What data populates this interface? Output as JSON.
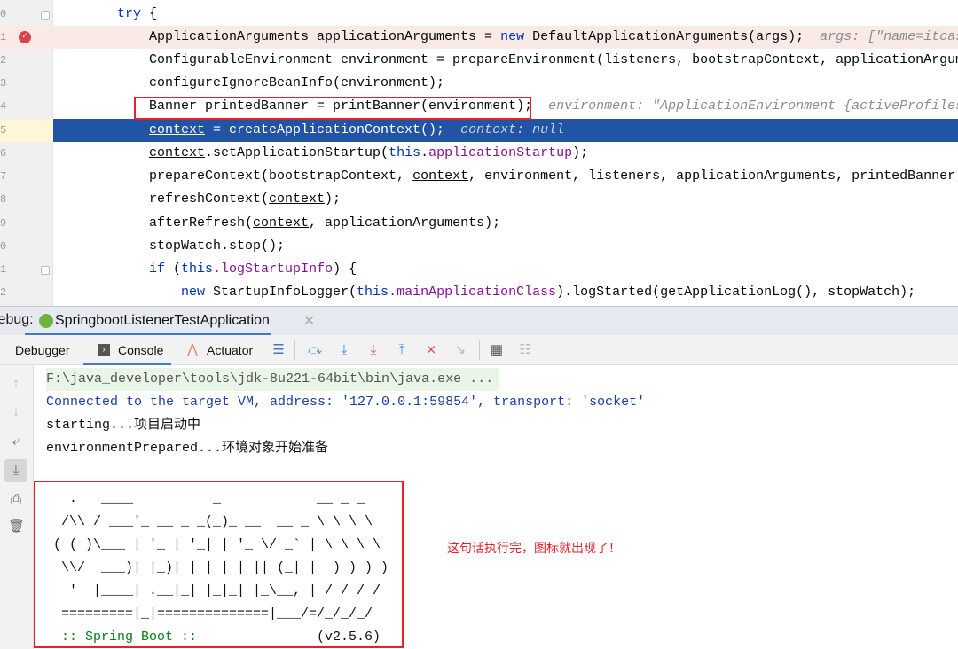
{
  "editor": {
    "lines": [
      {
        "num": "0",
        "parts": [
          {
            "t": "try {",
            "c": "kw-mix"
          }
        ]
      },
      {
        "num": "1"
      },
      {
        "num": "2"
      },
      {
        "num": "3"
      },
      {
        "num": "4"
      },
      {
        "num": "5"
      },
      {
        "num": "6"
      },
      {
        "num": "7"
      },
      {
        "num": "8"
      },
      {
        "num": "9"
      },
      {
        "num": "0"
      },
      {
        "num": "1"
      },
      {
        "num": "2"
      }
    ],
    "l0_kw": "try",
    "l0_rest": " {",
    "l1_code": "ApplicationArguments applicationArguments = ",
    "l1_new": "new",
    "l1_rest": " DefaultApplicationArguments(args);",
    "l1_hint": "args: [\"name=itcast\"]",
    "l2_code": "ConfigurableEnvironment environment = prepareEnvironment(listeners, bootstrapContext, applicationArguments);",
    "l3_code": "configureIgnoreBeanInfo(environment);",
    "l4_code": "Banner printedBanner = printBanner(environment);",
    "l4_hint": "environment: \"ApplicationEnvironment {activeProfiles=[]}\"",
    "l5_var": "context",
    "l5_rest": " = createApplicationContext();",
    "l5_hint": "context: null",
    "l6_var": "context",
    "l6_a": ".setApplicationStartup(",
    "l6_this": "this",
    "l6_dot": ".",
    "l6_fld": "applicationStartup",
    "l6_end": ");",
    "l7_a": "prepareContext(bootstrapContext, ",
    "l7_var": "context",
    "l7_b": ", environment, listeners, applicationArguments, printedBanner);",
    "l8_a": "refreshContext(",
    "l8_var": "context",
    "l8_b": ");",
    "l9_a": "afterRefresh(",
    "l9_var": "context",
    "l9_b": ", applicationArguments);",
    "l10_code": "stopWatch.stop();",
    "l11_if": "if",
    "l11_a": " (",
    "l11_this": "this",
    "l11_fld": ".logStartupInfo",
    "l11_b": ") {",
    "l12_new": "new",
    "l12_a": " StartupInfoLogger(",
    "l12_this": "this",
    "l12_fld": ".mainApplicationClass",
    "l12_b": ").logStarted(getApplicationLog(), stopWatch);"
  },
  "debug": {
    "label": "Debug:",
    "session_tab": "SpringbootListenerTestApplication",
    "tabs": [
      "Debugger",
      "Console",
      "Actuator"
    ]
  },
  "console": {
    "cmd": "F:\\java_developer\\tools\\jdk-8u221-64bit\\bin\\java.exe ...",
    "connected": "Connected to the target VM, address: '127.0.0.1:59854', transport: 'socket'",
    "starting": "starting...项目启动中",
    "env": "environmentPrepared...环境对象开始准备",
    "banner": [
      "  .   ____          _            __ _ _",
      " /\\\\ / ___'_ __ _ _(_)_ __  __ _ \\ \\ \\ \\",
      "( ( )\\___ | '_ | '_| | '_ \\/ _` | \\ \\ \\ \\",
      " \\\\/  ___)| |_)| | | | | || (_| |  ) ) ) )",
      "  '  |____| .__|_| |_|_| |_\\__, | / / / /",
      " =========|_|==============|___/=/_/_/_/"
    ],
    "spring_boot": " :: Spring Boot ::",
    "version": "(v2.5.6)",
    "annotation": "这句话执行完，图标就出现了！"
  },
  "colors": {
    "highlight": "#2154a5",
    "annotation": "#e8202a",
    "green": "#067d17"
  }
}
